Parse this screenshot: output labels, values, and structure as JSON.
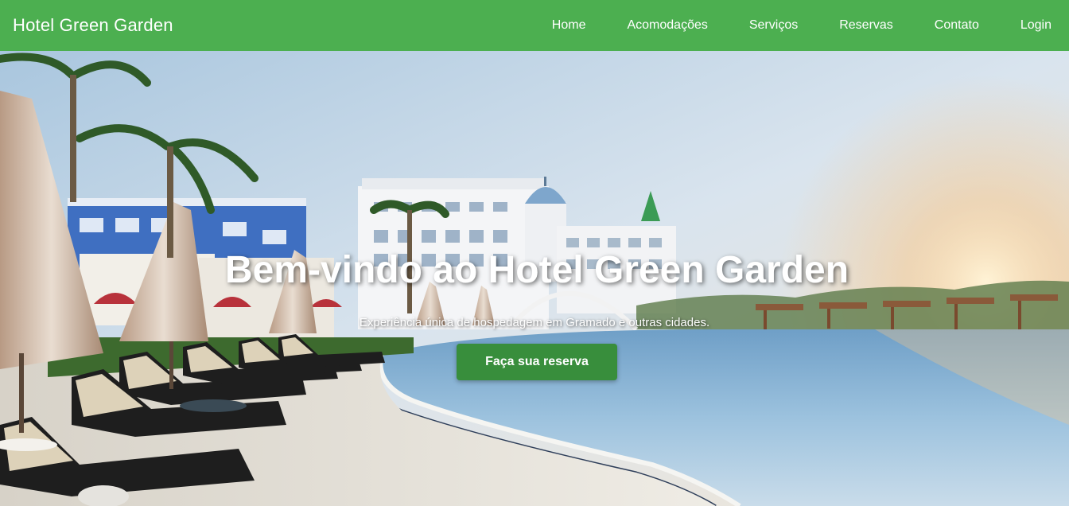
{
  "header": {
    "brand": "Hotel Green Garden",
    "nav": [
      {
        "label": "Home"
      },
      {
        "label": "Acomodações"
      },
      {
        "label": "Serviços"
      },
      {
        "label": "Reservas"
      },
      {
        "label": "Contato"
      },
      {
        "label": "Login"
      }
    ]
  },
  "hero": {
    "title": "Bem-vindo ao Hotel Green Garden",
    "subtitle": "Experiência única de hospedagem em Gramado e outras cidades.",
    "cta_label": "Faça sua reserva",
    "image": "hotel-pool-resort-photo"
  },
  "colors": {
    "nav_background": "#4caf50",
    "cta_background": "#388e3c",
    "text": "#ffffff"
  }
}
